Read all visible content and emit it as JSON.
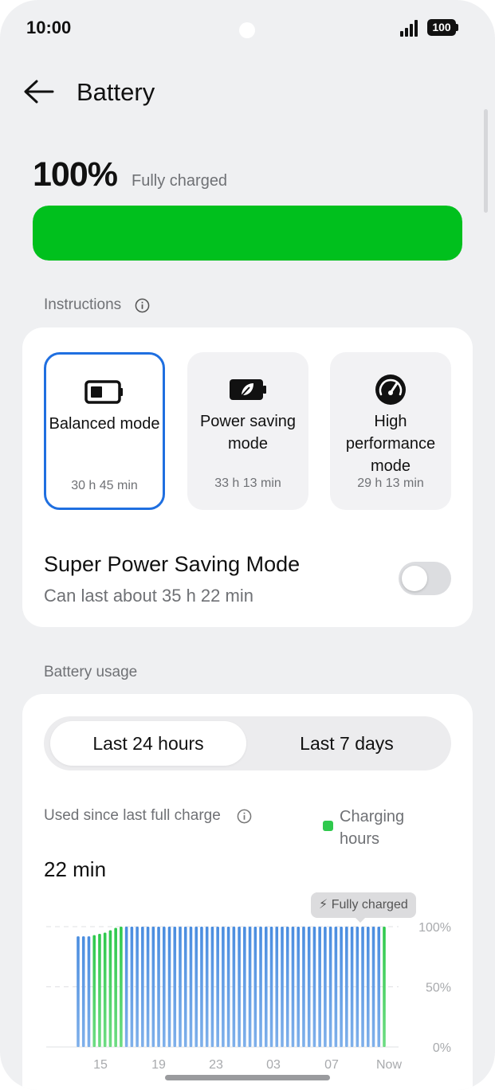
{
  "status_bar": {
    "time": "10:00",
    "battery": "100"
  },
  "header": {
    "title": "Battery"
  },
  "battery": {
    "percent": "100%",
    "status": "Fully charged",
    "level": 1.0,
    "fill_color": "#00c01d"
  },
  "instructions": {
    "label": "Instructions"
  },
  "modes": [
    {
      "name": "Balanced mode",
      "time": "30 h 45 min",
      "icon": "battery-icon",
      "selected": true
    },
    {
      "name": "Power saving mode",
      "time": "33 h 13 min",
      "icon": "leaf-battery-icon",
      "selected": false
    },
    {
      "name": "High performance mode",
      "time": "29 h 13 min",
      "icon": "speedometer-icon",
      "selected": false
    }
  ],
  "super_power_saving": {
    "title": "Super Power Saving Mode",
    "subtitle": "Can last about 35 h 22 min",
    "enabled": false
  },
  "usage": {
    "section_label": "Battery usage",
    "tabs": [
      {
        "label": "Last 24 hours",
        "active": true
      },
      {
        "label": "Last 7 days",
        "active": false
      }
    ],
    "used_label": "Used since last full charge",
    "used_value": "22 min",
    "legend": "Charging hours"
  },
  "colors": {
    "accent": "#1f6fe0",
    "charging": "#2fc94d",
    "discharging": "#4b8fe0"
  },
  "chart_data": {
    "type": "bar",
    "x_tick_labels": [
      "15",
      "19",
      "23",
      "03",
      "07",
      "Now"
    ],
    "y_tick_labels": [
      "100%",
      "50%",
      "0%"
    ],
    "ylim": [
      0,
      100
    ],
    "annotation": "Fully charged",
    "legend": [
      "Charging hours"
    ],
    "series": [
      {
        "name": "Charging hours",
        "values": [
          92,
          92,
          92,
          93,
          94,
          95,
          97,
          99,
          100,
          100,
          100,
          100,
          100,
          100,
          100,
          100,
          100,
          100,
          100,
          100,
          100,
          100,
          100,
          100,
          100,
          100,
          100,
          100,
          100,
          100,
          100,
          100,
          100,
          100,
          100,
          100,
          100,
          100,
          100,
          100,
          100,
          100,
          100,
          100,
          100,
          100,
          100,
          100,
          100,
          100,
          100,
          100,
          100,
          100,
          100,
          100,
          100,
          100
        ],
        "charging": [
          false,
          false,
          false,
          true,
          true,
          true,
          true,
          true,
          true,
          false,
          false,
          false,
          false,
          false,
          false,
          false,
          false,
          false,
          false,
          false,
          false,
          false,
          false,
          false,
          false,
          false,
          false,
          false,
          false,
          false,
          false,
          false,
          false,
          false,
          false,
          false,
          false,
          false,
          false,
          false,
          false,
          false,
          false,
          false,
          false,
          false,
          false,
          false,
          false,
          false,
          false,
          false,
          false,
          false,
          false,
          false,
          false,
          true
        ]
      }
    ],
    "grid": true
  }
}
